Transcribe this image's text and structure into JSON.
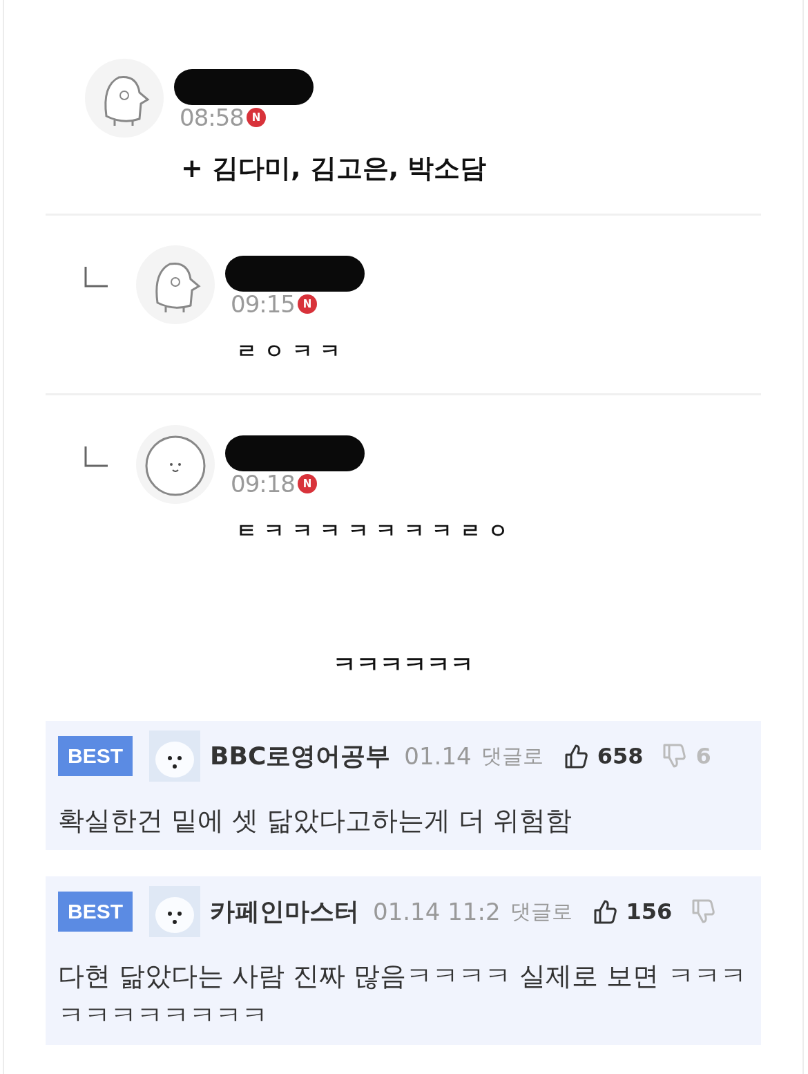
{
  "thread": [
    {
      "time": "08:58",
      "badge": "N",
      "text": "+ 김다미, 김고은, 박소담",
      "reply": false,
      "kind": "penguin"
    },
    {
      "time": "09:15",
      "badge": "N",
      "text": "ㄹ ㅇ ㅋ ㅋ",
      "reply": true,
      "kind": "penguin"
    },
    {
      "time": "09:18",
      "badge": "N",
      "text": "ㅌ ㅋ ㅋ ㅋ ㅋ ㅋ ㅋ ㅋ  ㄹ ㅇ",
      "reply": true,
      "kind": "blob"
    }
  ],
  "caption": "ㅋㅋㅋㅋㅋㅋ",
  "best_comments": [
    {
      "badge": "BEST",
      "author": "BBC로영어공부",
      "time": "01.14",
      "reply_link": "댓글로",
      "likes": "658",
      "dislikes": "6",
      "text": "확실한건 밑에 셋 닮았다고하는게 더 위험함"
    },
    {
      "badge": "BEST",
      "author": "카페인마스터",
      "time": "01.14 11:2",
      "reply_link": "댓글로",
      "likes": "156",
      "text": "다현 닮았다는 사람 진짜 많음ㅋㅋㅋㅋ 실제로 보면 ㅋㅋㅋㅋㅋㅋㅋㅋㅋㅋㅋ"
    }
  ]
}
